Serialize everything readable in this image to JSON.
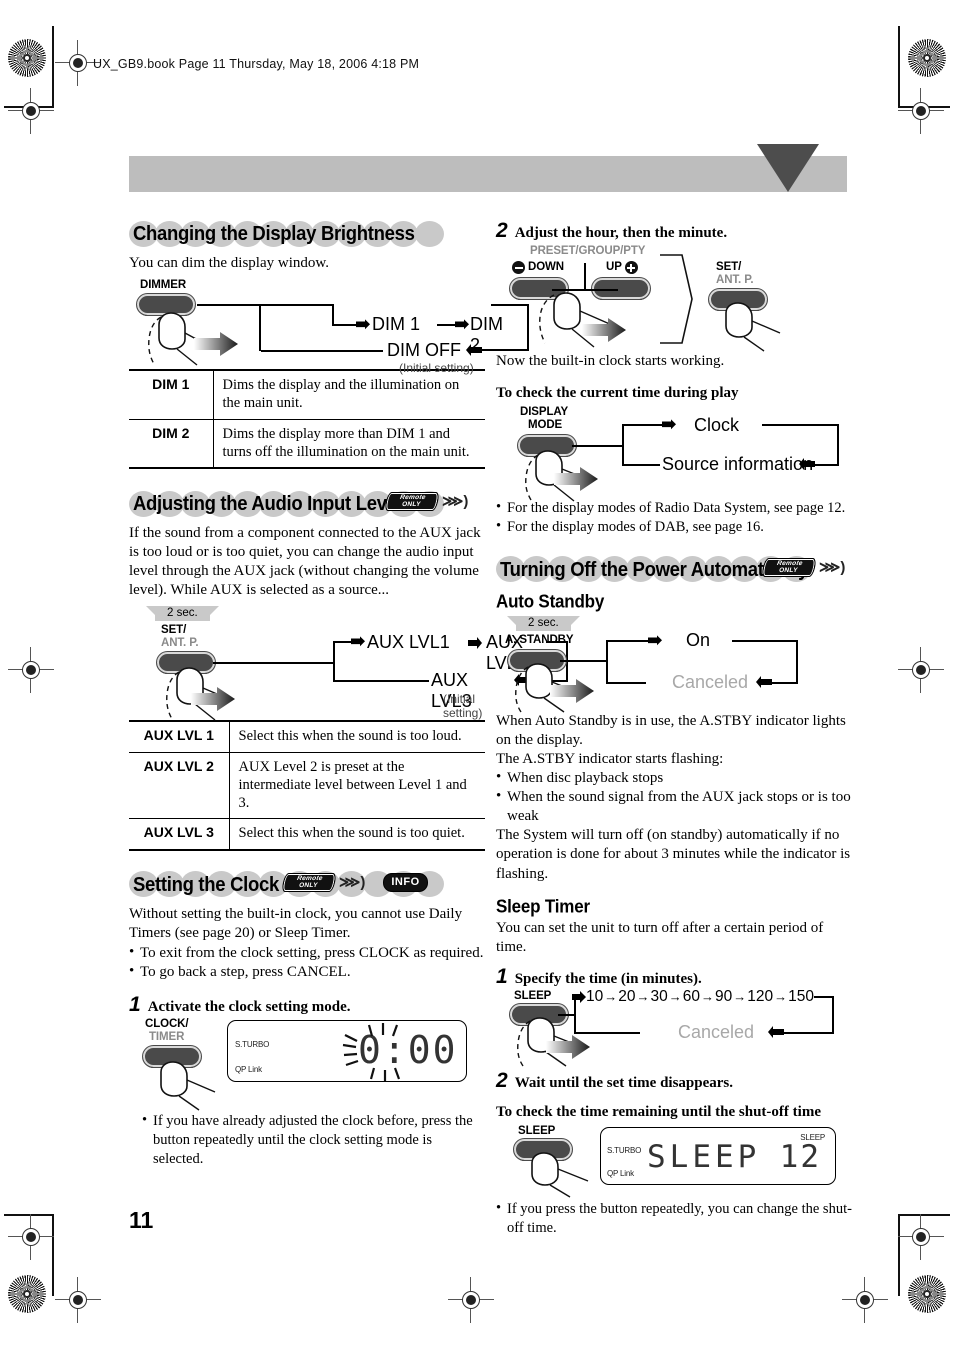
{
  "header": {
    "file_info": "UX_GB9.book  Page 11  Thursday, May 18, 2006  4:18 PM"
  },
  "page_number": "11",
  "badges": {
    "remote_line1": "Remote",
    "remote_line2": "ONLY",
    "wave_glyph": "⋙)",
    "info_label": "INFO"
  },
  "left_column": {
    "sections": [
      {
        "id": "changing-display-brightness",
        "title": "Changing the Display Brightness",
        "intro": "You can dim the display window.",
        "diagram": {
          "button_label": "DIMMER",
          "flow": [
            "DIM 1",
            "DIM 2",
            "DIM OFF"
          ],
          "initial_note": "(Initial setting)"
        },
        "table": {
          "rows": [
            {
              "key": "DIM 1",
              "value": "Dims the display and the illumination on the main unit."
            },
            {
              "key": "DIM 2",
              "value": "Dims the display more than DIM 1 and turns off the illumination on the main unit."
            }
          ]
        }
      },
      {
        "id": "adjusting-audio-input-level",
        "title": "Adjusting the Audio Input Level",
        "intro": "If the sound from a component connected to the AUX jack is too loud or is too quiet, you can change the audio input level through the AUX jack (without changing the volume level). While AUX is selected as a source...",
        "diagram": {
          "hold_label": "2 sec.",
          "button_label_1": "SET/",
          "button_label_2": "ANT. P.",
          "flow": [
            "AUX LVL1",
            "AUX LVL2",
            "AUX LVL3"
          ],
          "initial_note": "(Initial setting)"
        },
        "table": {
          "rows": [
            {
              "key": "AUX LVL 1",
              "value": "Select this when the sound is too loud."
            },
            {
              "key": "AUX LVL 2",
              "value": "AUX Level 2 is preset at the intermediate level between Level 1 and 3."
            },
            {
              "key": "AUX LVL 3",
              "value": "Select this when the sound is too quiet."
            }
          ]
        }
      },
      {
        "id": "setting-the-clock",
        "title": "Setting the Clock",
        "intro": "Without setting the built-in clock, you cannot use Daily Timers (see page 20) or Sleep Timer.",
        "bullets": [
          "To exit from the clock setting, press CLOCK as required.",
          "To go back a step, press CANCEL."
        ],
        "step1": {
          "number": "1",
          "text": "Activate the clock setting mode.",
          "button_label_1": "CLOCK/",
          "button_label_2": "TIMER",
          "display": {
            "indicator_1": "S.TURBO",
            "indicator_2": "QP Link",
            "readout": "0:00"
          },
          "note": "If you have already adjusted the clock before, press the button repeatedly until the clock setting mode is selected."
        }
      }
    ]
  },
  "right_column": {
    "step2": {
      "number": "2",
      "text": "Adjust the hour, then the minute.",
      "group_label": "PRESET/GROUP/PTY",
      "down_label": "DOWN",
      "up_label": "UP",
      "minus_glyph": "➖",
      "plus_glyph": "➕",
      "set_label_1": "SET/",
      "set_label_2": "ANT. P.",
      "after_text": "Now the built-in clock starts working."
    },
    "check_time": {
      "heading": "To check the current time during play",
      "button_label_1": "DISPLAY",
      "button_label_2": "MODE",
      "flow": [
        "Clock",
        "Source information"
      ],
      "bullets": [
        "For the display modes of Radio Data System, see page 12.",
        "For the display modes of DAB, see page 16."
      ]
    },
    "power_section": {
      "id": "turning-off-power-automatically",
      "title": "Turning Off the Power Automatically",
      "auto_standby": {
        "heading": "Auto Standby",
        "hold_label": "2 sec.",
        "button_label": "A. STANDBY",
        "flow": [
          "On",
          "Canceled"
        ],
        "paragraphs": [
          "When Auto Standby is in use, the A.STBY indicator lights on the display.",
          "The A.STBY indicator starts flashing:"
        ],
        "bullets": [
          "When disc playback stops",
          "When the sound signal from the AUX jack stops or is too weak"
        ],
        "closing": "The System will turn off (on standby) automatically if no operation is done for about 3 minutes while the indicator is flashing."
      },
      "sleep_timer": {
        "heading": "Sleep Timer",
        "intro": "You can set the unit to turn off after a certain period of time.",
        "step1": {
          "number": "1",
          "text": "Specify the time (in minutes).",
          "button_label": "SLEEP",
          "values": [
            "10",
            "20",
            "30",
            "60",
            "90",
            "120",
            "150"
          ],
          "canceled_label": "Canceled"
        },
        "step2": {
          "number": "2",
          "text": "Wait until the set time disappears."
        },
        "check": {
          "heading": "To check the time remaining until the shut-off time",
          "button_label": "SLEEP",
          "display": {
            "indicator_1": "S.TURBO",
            "indicator_2": "QP Link",
            "indicator_3": "SLEEP",
            "readout": "SLEEP",
            "readout_value": "12"
          },
          "bullet": "If you press the button repeatedly, you can change the shut-off time."
        }
      }
    }
  },
  "colors": {
    "banner_gray": "#bdbdbd",
    "banner_triangle": "#4d4d4d",
    "bubble_gray": "#c9c9c9",
    "button_dark": "#4a4a4a",
    "gray_text": "#a8a8a8"
  }
}
